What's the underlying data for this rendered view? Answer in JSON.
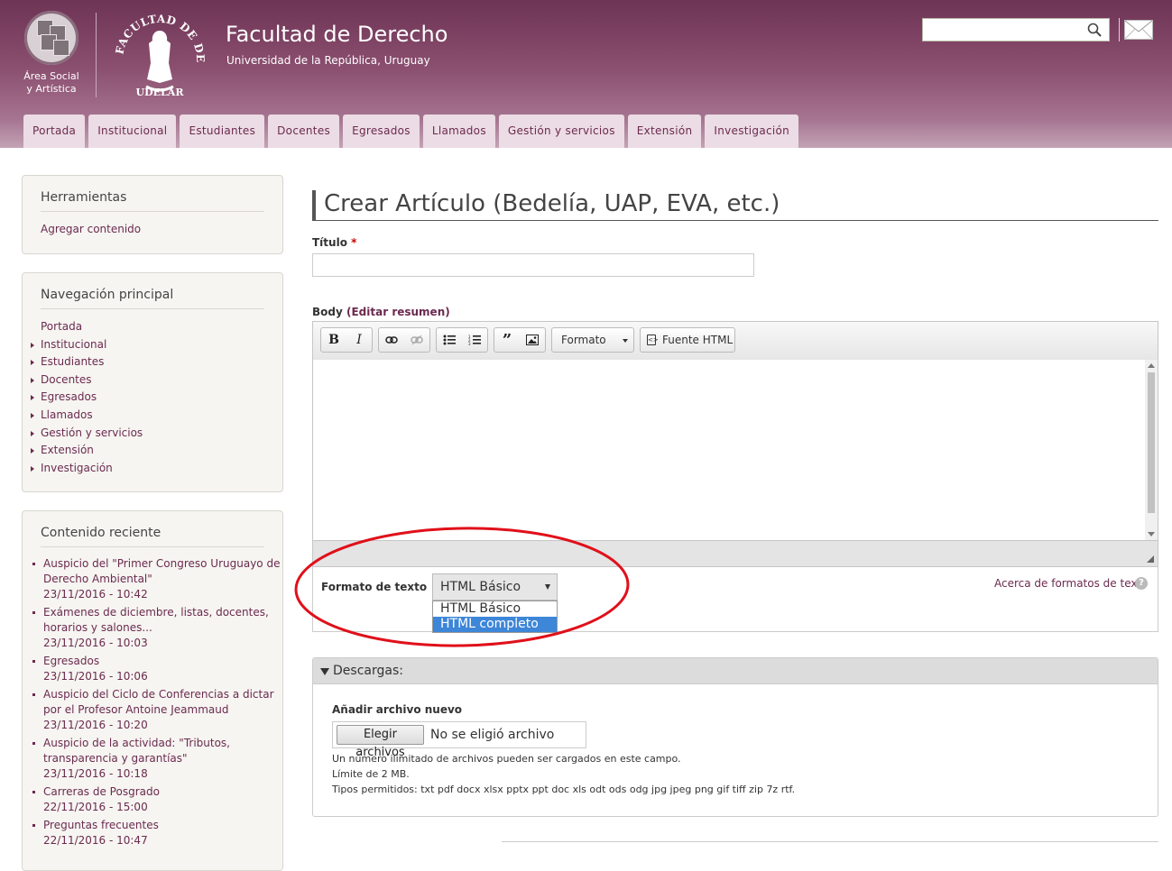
{
  "header": {
    "site_name": "Facultad de Derecho",
    "site_slogan": "Universidad de la República, Uruguay",
    "area_logo_text_line1": "Área Social",
    "area_logo_text_line2": "y Artística",
    "seal_text_top": "FACULTAD DE DERECHO",
    "seal_text_bottom": "UDELAR",
    "search_placeholder": ""
  },
  "main_menu": [
    "Portada",
    "Institucional",
    "Estudiantes",
    "Docentes",
    "Egresados",
    "Llamados",
    "Gestión y servicios",
    "Extensión",
    "Investigación"
  ],
  "sidebar": {
    "tools": {
      "title": "Herramientas",
      "items": [
        "Agregar contenido"
      ]
    },
    "main_nav": {
      "title": "Navegación principal",
      "items": [
        "Portada",
        "Institucional",
        "Estudiantes",
        "Docentes",
        "Egresados",
        "Llamados",
        "Gestión y servicios",
        "Extensión",
        "Investigación"
      ]
    },
    "recent": {
      "title": "Contenido reciente",
      "items": [
        {
          "title": "Auspicio del \"Primer Congreso Uruguayo de Derecho Ambiental\"",
          "date": "23/11/2016 - 10:42"
        },
        {
          "title": "Exámenes de diciembre, listas, docentes, horarios y salones...",
          "date": "23/11/2016 - 10:03"
        },
        {
          "title": "Egresados",
          "date": "23/11/2016 - 10:06"
        },
        {
          "title": "Auspicio del Ciclo de Conferencias a dictar por el Profesor Antoine Jeammaud",
          "date": "23/11/2016 - 10:20"
        },
        {
          "title": "Auspicio de la actividad: \"Tributos, transparencia y garantías\"",
          "date": "23/11/2016 - 10:18"
        },
        {
          "title": "Carreras de Posgrado",
          "date": "22/11/2016 - 15:00"
        },
        {
          "title": "Preguntas frecuentes",
          "date": "22/11/2016 - 10:47"
        }
      ]
    }
  },
  "page": {
    "title": "Crear Artículo (Bedelía, UAP, EVA, etc.)",
    "title_field_label": "Título",
    "required_mark": "*",
    "title_value": "",
    "body_label": "Body",
    "edit_summary_link": "(Editar resumen)",
    "toolbar": {
      "bold": "B",
      "italic": "I",
      "format_combo": "Formato",
      "source_button": "Fuente HTML"
    },
    "text_format_label": "Formato de texto",
    "text_format_selected": "HTML Básico",
    "text_format_options": [
      "HTML Básico",
      "HTML completo"
    ],
    "about_formats_link": "Acerca de formatos de texto",
    "help_icon_glyph": "?"
  },
  "downloads": {
    "legend": "Descargas:",
    "add_file_label": "Añadir archivo nuevo",
    "choose_button": "Elegir archivos",
    "no_file_text": "No se eligió archivo",
    "help_lines": [
      "Un número ilimitado de archivos pueden ser cargados en este campo.",
      "Límite de 2 MB.",
      "Tipos permitidos: txt pdf docx xlsx pptx ppt doc xls odt ods odg jpg jpeg png gif tiff zip 7z rtf."
    ]
  },
  "colors": {
    "brand": "#6b2a4f",
    "header_top": "#6e3455",
    "annotation": "#e0101a",
    "selected_option": "#3d86d8"
  }
}
